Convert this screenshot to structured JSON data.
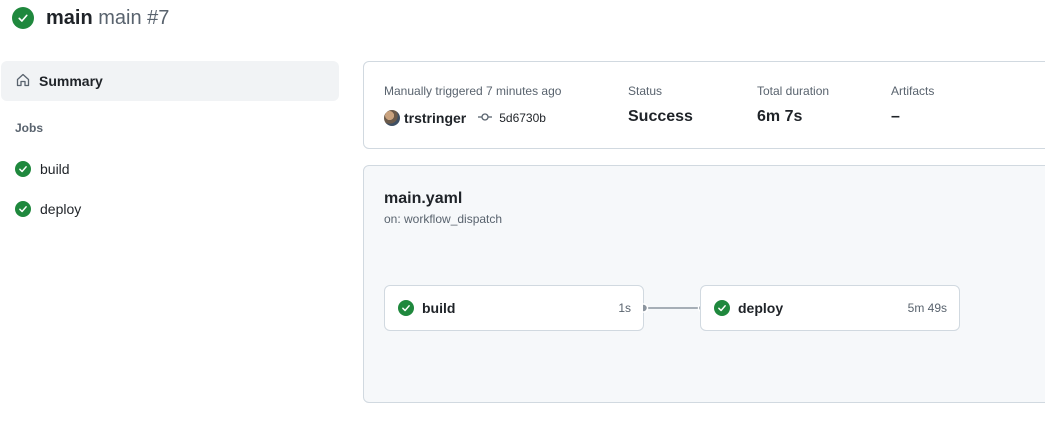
{
  "run": {
    "branch": "main",
    "name": "main #7",
    "status_icon": "check-circle-fill-icon"
  },
  "sidebar": {
    "summary_label": "Summary",
    "jobs_heading": "Jobs",
    "jobs": [
      {
        "label": "build",
        "status": "success"
      },
      {
        "label": "deploy",
        "status": "success"
      }
    ]
  },
  "summary": {
    "trigger_text": "Manually triggered 7 minutes ago",
    "actor": "trstringer",
    "commit": "5d6730b",
    "status_label": "Status",
    "status_value": "Success",
    "duration_label": "Total duration",
    "duration_value": "6m 7s",
    "artifacts_label": "Artifacts",
    "artifacts_value": "–"
  },
  "workflow": {
    "file": "main.yaml",
    "trigger": "on: workflow_dispatch",
    "jobs": [
      {
        "name": "build",
        "duration": "1s"
      },
      {
        "name": "deploy",
        "duration": "5m 49s"
      }
    ]
  },
  "colors": {
    "success": "#1f883d",
    "muted_text": "#59636e",
    "border": "#d1d9e0"
  }
}
